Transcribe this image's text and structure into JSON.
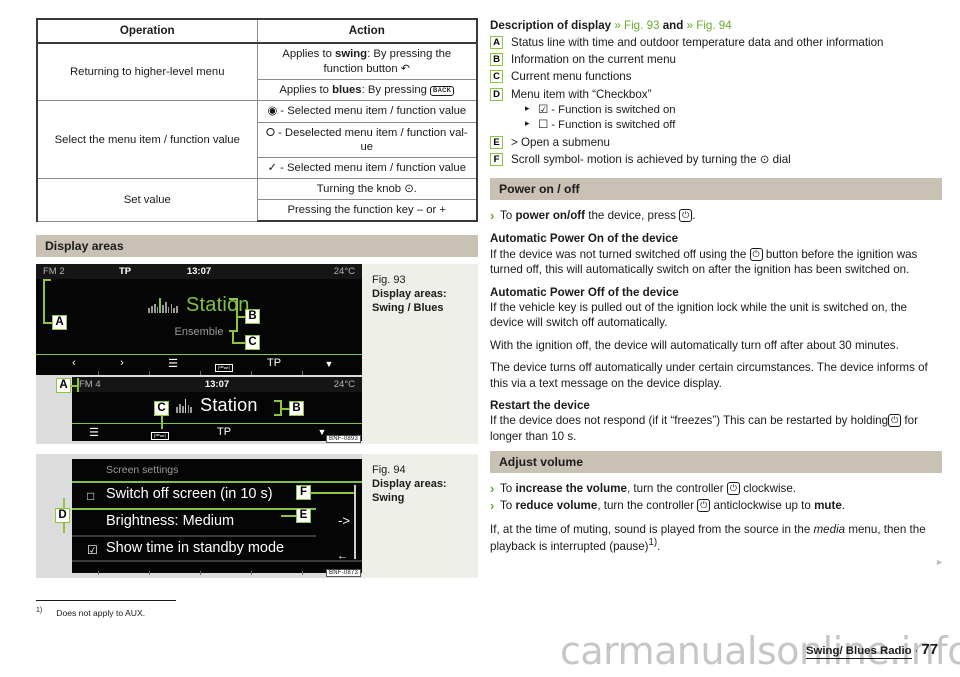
{
  "table": {
    "headers": [
      "Operation",
      "Action"
    ],
    "rows": [
      {
        "operation": "Returning to higher-level menu",
        "actions": [
          "Applies to swing: By pressing the function button ↶",
          "Applies to blues: By pressing BACK"
        ]
      },
      {
        "operation": "Select the menu item / function value",
        "actions": [
          "◉ - Selected menu item / function value",
          "⭘ - Deselected menu item / function value",
          "✓ - Selected menu item / function value"
        ]
      },
      {
        "operation": "Set value",
        "actions": [
          "Turning the knob ⊙.",
          "Pressing the function key – or +"
        ]
      }
    ],
    "cells": {
      "r1_op": "Returning to higher-level menu",
      "r1_a1_pre": "Applies to ",
      "r1_a1_bold": "swing",
      "r1_a1_post": ": By pressing the function button ",
      "r1_a1_glyph": "↶",
      "r1_a2_pre": "Applies to ",
      "r1_a2_bold": "blues",
      "r1_a2_post": ": By pressing ",
      "r1_a2_key": "BACK",
      "r2_op": "Select the menu item / function value",
      "r2_a1": "◉ - Selected menu item / function value",
      "r2_a2": "⭘ - Deselected menu item / function val-ue",
      "r2_a3": "✓ - Selected menu item / function value",
      "r3_op": "Set value",
      "r3_a1": "Turning the knob ⊙.",
      "r3_a2": "Pressing the function key – or +"
    }
  },
  "display_areas": {
    "heading": "Display areas",
    "fig93": {
      "caption_num": "Fig. 93",
      "caption_line1": "Display areas:",
      "caption_line2": "Swing / Blues",
      "ref_code": "BNF-0893",
      "screen_top": {
        "band": "FM 2",
        "tp": "TP",
        "time": "13:07",
        "temp": "24°C",
        "station": "Station",
        "ensemble": "Ensemble",
        "func_prev": "‹",
        "func_next": "›",
        "func_list": "☰",
        "func_tp": "TP",
        "func_down": "▼"
      },
      "screen_bottom": {
        "band": "FM 4",
        "time": "13:07",
        "temp": "24°C",
        "station": "Station",
        "func_list": "☰",
        "func_tp": "TP",
        "func_down": "▼"
      },
      "callouts": [
        "A",
        "B",
        "C",
        "A",
        "B",
        "C"
      ]
    },
    "fig94": {
      "caption_num": "Fig. 94",
      "caption_line1": "Display areas:",
      "caption_line2": "Swing",
      "ref_code": "BNF-0873",
      "title": "Screen settings",
      "items": [
        {
          "checkbox": "□",
          "label": "Switch off screen (in 10 s)"
        },
        {
          "checkbox": "",
          "label": "Brightness: Medium",
          "submenu": "->"
        },
        {
          "checkbox": "☑",
          "label": "Show time in standby mode"
        }
      ],
      "back_arrow": "←",
      "callouts": [
        "D",
        "E",
        "F"
      ]
    }
  },
  "description": {
    "title": "Description of display",
    "ref1": "» Fig. 93",
    "and": "and",
    "ref2": "» Fig. 94",
    "items": [
      {
        "letter": "A",
        "text": "Status line with time and outdoor temperature data and other information"
      },
      {
        "letter": "B",
        "text": "Information on the current menu"
      },
      {
        "letter": "C",
        "text": "Current menu functions"
      },
      {
        "letter": "D",
        "text": "Menu item with “Checkbox”",
        "sub": [
          "☑ - Function is switched on",
          "☐ - Function is switched off"
        ]
      },
      {
        "letter": "E",
        "text": "> Open a submenu"
      },
      {
        "letter": "F",
        "text": "Scroll symbol- motion is achieved by turning the ⊙ dial"
      }
    ]
  },
  "power": {
    "heading": "Power on / off",
    "bullet_pre": "To ",
    "bullet_bold": "power on/off",
    "bullet_post": " the device, press ",
    "bullet_glyph": "⏻",
    "bullet_end": ".",
    "auto_on_head": "Automatic Power On of the device",
    "auto_on_p1": "If the device was not turned switched off using the ",
    "auto_on_p2": " button before the ignition was turned off, this will automatically switch on after the ignition has been switched on.",
    "auto_off_head": "Automatic Power Off of the device",
    "auto_off_p1": "If the vehicle key is pulled out of the ignition lock while the unit is switched on, the device will switch off automatically.",
    "auto_off_p2": "With the ignition off, the device will automatically turn off after about 30 minutes.",
    "auto_off_p3": "The device turns off automatically under certain circumstances. The device informs of this via a text message on the device display.",
    "restart_head": "Restart the device",
    "restart_p1": "If the device does not respond (if it “freezes”) This can be restarted by holding",
    "restart_p2": " for longer than 10 s."
  },
  "volume": {
    "heading": "Adjust volume",
    "b1_pre": "To ",
    "b1_bold": "increase the volume",
    "b1_mid": ", turn the controller ",
    "b1_post": " clockwise.",
    "b2_pre": "To ",
    "b2_bold": "reduce volume",
    "b2_mid": ", turn the controller ",
    "b2_post": " anticlockwise up to ",
    "b2_bold2": "mute",
    "b2_end": ".",
    "note_pre": "If, at the time of muting, sound is played from the source in the ",
    "note_ital": "media",
    "note_post": " menu, then the playback is interrupted (pause)",
    "note_sup": "1)",
    "note_end": "."
  },
  "footnote": {
    "marker": "1)",
    "text": "Does not apply to AUX."
  },
  "page_footer": {
    "title": "Swing/ Blues Radio",
    "separator": "·",
    "number": "77"
  },
  "watermark": "carmanualsonline.info",
  "colors": {
    "section_bar": "#c9c2b4",
    "callout_green": "#8cc63f",
    "screen_green": "#7ec24a",
    "link_green": "#6aaa2e",
    "screen_black": "#050505",
    "figure_bg": "#efefea"
  }
}
